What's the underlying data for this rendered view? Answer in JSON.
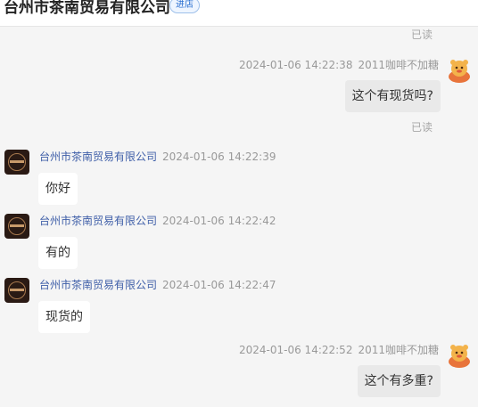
{
  "header": {
    "title": "台州市茶南贸易有限公司",
    "badge": "进店"
  },
  "messages": [
    {
      "kind": "read",
      "text": "已读"
    },
    {
      "kind": "mine",
      "time": "2024-01-06 14:22:38",
      "sender": "2011咖啡不加糖",
      "text": "这个有现货吗?",
      "status": "已读"
    },
    {
      "kind": "theirs",
      "sender": "台州市茶南贸易有限公司",
      "time": "2024-01-06 14:22:39",
      "text": "你好"
    },
    {
      "kind": "theirs",
      "sender": "台州市茶南贸易有限公司",
      "time": "2024-01-06 14:22:42",
      "text": "有的"
    },
    {
      "kind": "theirs",
      "sender": "台州市茶南贸易有限公司",
      "time": "2024-01-06 14:22:47",
      "text": "现货的"
    },
    {
      "kind": "mine",
      "time": "2024-01-06 14:22:52",
      "sender": "2011咖啡不加糖",
      "text": "这个有多重?"
    }
  ],
  "colors": {
    "shop_name": "#3e5ea8",
    "badge": "#2a6fd0",
    "my_bubble": "#e9e9e9",
    "their_bubble": "#ffffff"
  }
}
